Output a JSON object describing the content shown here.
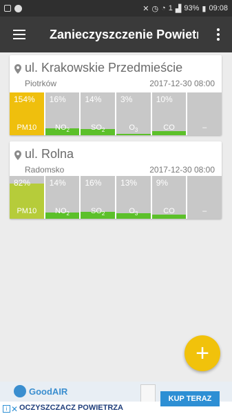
{
  "status_bar": {
    "battery": "93%",
    "time": "09:08",
    "sim": "1"
  },
  "app_bar": {
    "title": "Zanieczyszczenie Powietrza"
  },
  "stations": [
    {
      "street": "ul. Krakowskie Przedmieście",
      "city": "Piotrków",
      "datetime": "2017-12-30 08:00",
      "readings": [
        {
          "percent": "154%",
          "label": "PM10",
          "sub": "",
          "color": "#efbf0d",
          "level_percent": 154
        },
        {
          "percent": "16%",
          "label": "NO",
          "sub": "2",
          "color": "#5cc02a",
          "level_percent": 16
        },
        {
          "percent": "14%",
          "label": "SO",
          "sub": "2",
          "color": "#5cc02a",
          "level_percent": 14
        },
        {
          "percent": "3%",
          "label": "O",
          "sub": "3",
          "color": "#5cc02a",
          "level_percent": 3
        },
        {
          "percent": "10%",
          "label": "CO",
          "sub": "",
          "color": "#5cc02a",
          "level_percent": 10
        },
        {
          "percent": "",
          "label": "–",
          "sub": "",
          "color": "#5cc02a",
          "level_percent": 0
        }
      ]
    },
    {
      "street": "ul. Rolna",
      "city": "Radomsko",
      "datetime": "2017-12-30 08:00",
      "readings": [
        {
          "percent": "82%",
          "label": "PM10",
          "sub": "",
          "color": "#b6cc3a",
          "level_percent": 82
        },
        {
          "percent": "14%",
          "label": "NO",
          "sub": "2",
          "color": "#5cc02a",
          "level_percent": 14
        },
        {
          "percent": "16%",
          "label": "SO",
          "sub": "2",
          "color": "#5cc02a",
          "level_percent": 16
        },
        {
          "percent": "13%",
          "label": "O",
          "sub": "3",
          "color": "#5cc02a",
          "level_percent": 13
        },
        {
          "percent": "9%",
          "label": "CO",
          "sub": "",
          "color": "#5cc02a",
          "level_percent": 9
        },
        {
          "percent": "",
          "label": "–",
          "sub": "",
          "color": "#5cc02a",
          "level_percent": 0
        }
      ]
    }
  ],
  "fab": {
    "icon": "plus-icon",
    "symbol": "+"
  },
  "ad": {
    "brand": "GoodAIR",
    "headline": "OCZYSZCZACZ POWIETRZA",
    "cta": "KUP TERAZ",
    "adchoices_label": "i",
    "close_label": "✕"
  },
  "colors": {
    "appbar": "#3a3a3a",
    "statusbar": "#2f2f2f",
    "background": "#ececec",
    "fab": "#f1c20b",
    "good": "#5cc02a",
    "bad": "#efbf0d",
    "moderate": "#b6cc3a"
  }
}
